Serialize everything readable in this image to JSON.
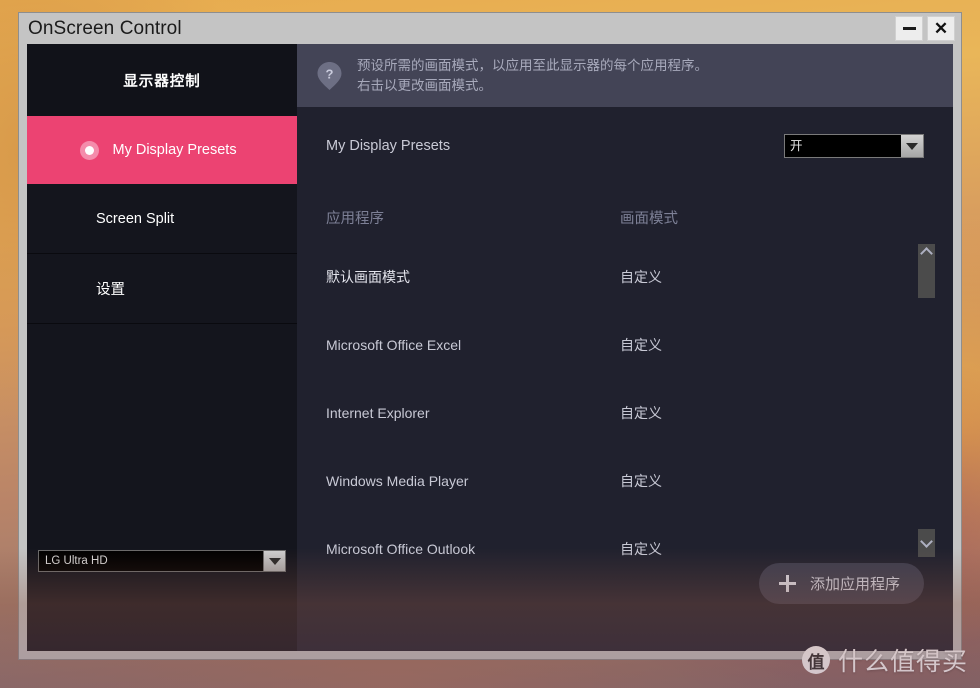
{
  "window": {
    "title": "OnScreen Control",
    "minimize_label": "—",
    "close_label": "✕"
  },
  "sidebar": {
    "header": {
      "label": "显示器控制"
    },
    "items": [
      {
        "label": "My Display Presets",
        "selected": true
      },
      {
        "label": "Screen Split",
        "selected": false
      },
      {
        "label": "设置",
        "selected": false
      }
    ],
    "monitor_select": {
      "value": "LG Ultra HD"
    },
    "accent_color": "#ec4372"
  },
  "main": {
    "help_icon": "help-question-icon",
    "header_line1": "预设所需的画面模式，以应用至此显示器的每个应用程序。",
    "header_line2": "右击以更改画面模式。",
    "preset_label": "My Display Presets",
    "preset_toggle": {
      "value": "开"
    },
    "table": {
      "columns": [
        "应用程序",
        "画面模式"
      ],
      "rows": [
        {
          "app": "默认画面模式",
          "mode": "自定义"
        },
        {
          "app": "Microsoft Office Excel",
          "mode": "自定义"
        },
        {
          "app": "Internet Explorer",
          "mode": "自定义"
        },
        {
          "app": "Windows Media Player",
          "mode": "自定义"
        },
        {
          "app": "Microsoft Office Outlook",
          "mode": "自定义"
        }
      ]
    },
    "scrollbar": {
      "up_icon": "chevron-up-icon",
      "down_icon": "chevron-down-icon"
    },
    "add_button": {
      "label": "添加应用程序",
      "icon": "plus-icon"
    }
  },
  "watermark": {
    "logo_char": "值",
    "text": "什么值得买"
  }
}
